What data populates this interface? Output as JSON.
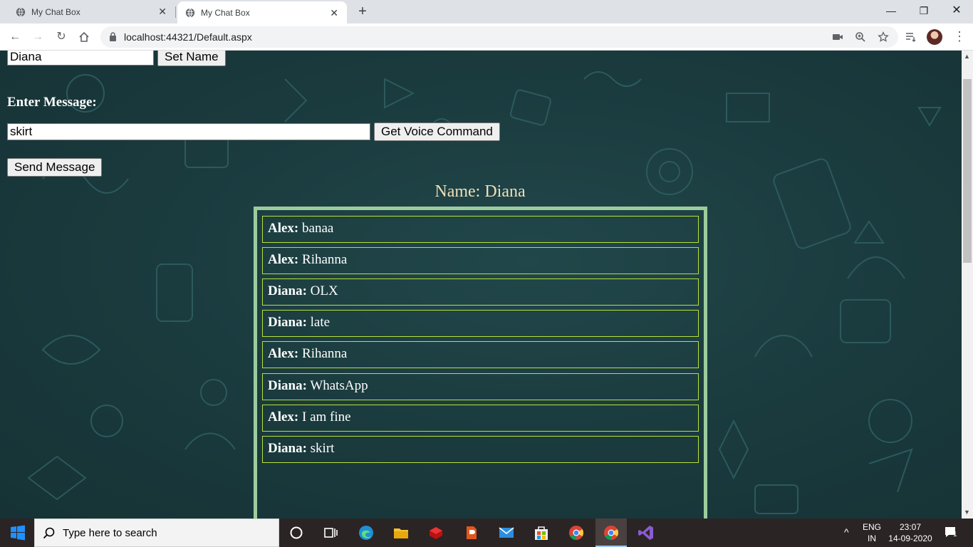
{
  "browser": {
    "tabs": [
      {
        "title": "My Chat Box",
        "active": false
      },
      {
        "title": "My Chat Box",
        "active": true
      }
    ],
    "new_tab": "+",
    "url": "localhost:44321/Default.aspx"
  },
  "form": {
    "name_value": "Diana",
    "set_name_label": "Set Name",
    "enter_message_label": "Enter Message:",
    "message_value": "skirt",
    "voice_button_label": "Get Voice Command",
    "send_button_label": "Send Message"
  },
  "chat": {
    "name_heading": "Name: Diana",
    "messages": [
      {
        "sender": "Alex:",
        "text": " banaa"
      },
      {
        "sender": "Alex:",
        "text": " Rihanna"
      },
      {
        "sender": "Diana:",
        "text": " OLX"
      },
      {
        "sender": "Diana:",
        "text": " late"
      },
      {
        "sender": "Alex:",
        "text": " Rihanna"
      },
      {
        "sender": "Diana:",
        "text": " WhatsApp"
      },
      {
        "sender": "Alex:",
        "text": " I am fine"
      },
      {
        "sender": "Diana:",
        "text": " skirt"
      }
    ]
  },
  "taskbar": {
    "search_placeholder": "Type here to search",
    "language": "ENG",
    "region": "IN",
    "time": "23:07",
    "date": "14-09-2020",
    "notification_count": "1"
  },
  "colors": {
    "page_bg": "#1b3b3e",
    "chat_border": "#9ccc9c",
    "message_border": "#b8e03a",
    "name_heading": "#f0deb8"
  }
}
